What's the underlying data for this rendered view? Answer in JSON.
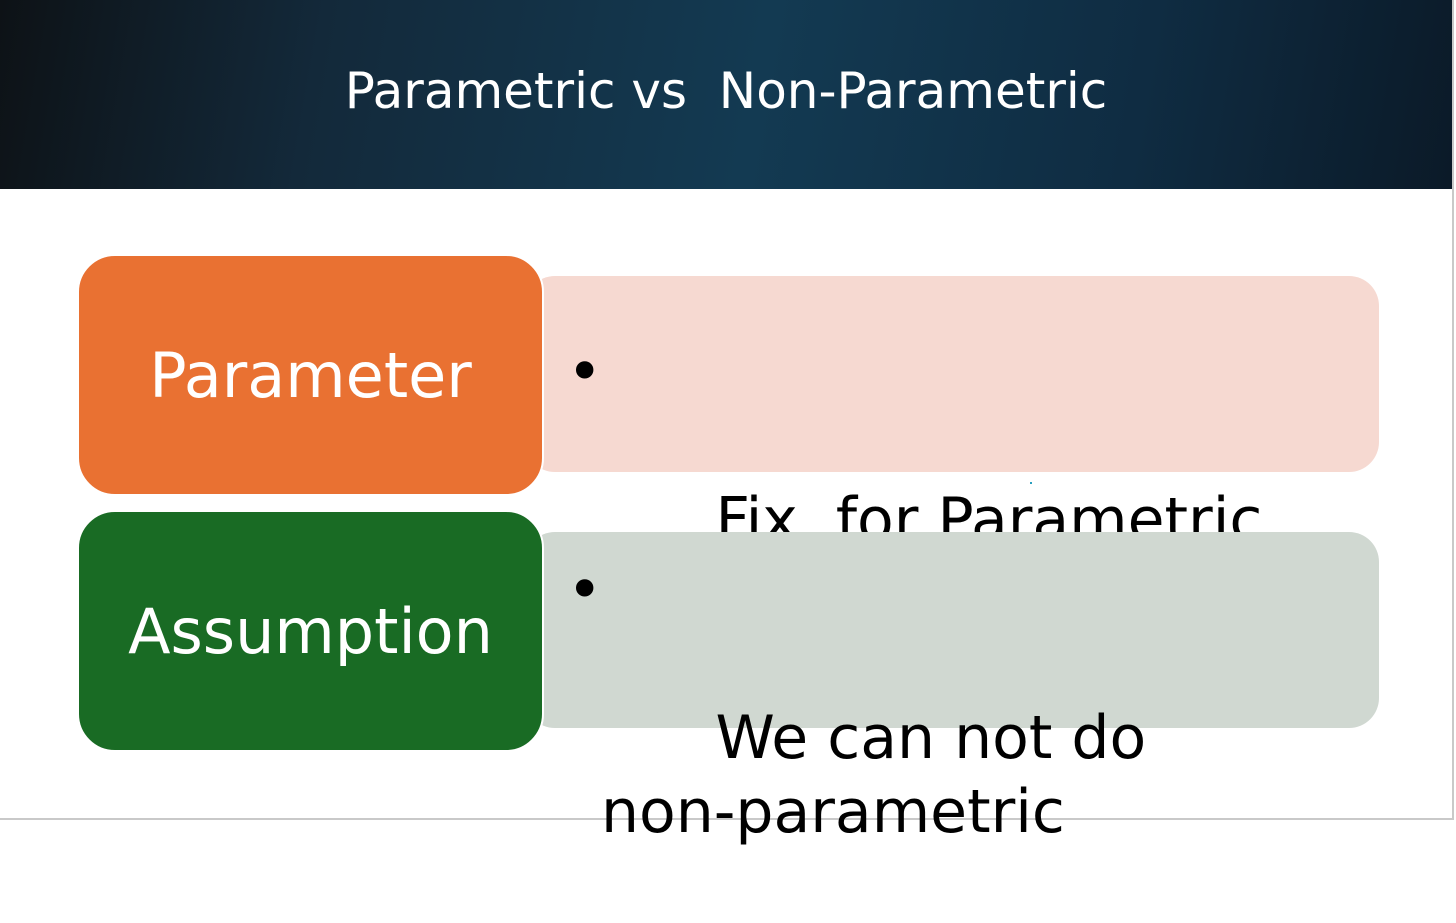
{
  "slide": {
    "title": "Parametric vs  Non-Parametric",
    "rows": [
      {
        "label": "Parameter",
        "label_color": "#E97132",
        "detail_bg": "#F6D9D1",
        "bullets": [
          "Fix  for Parametric"
        ]
      },
      {
        "label": "Assumption",
        "label_color": "#196B24",
        "detail_bg": "#D0D8D1",
        "bullets": [
          "We can not do  non-parametric"
        ]
      }
    ],
    "bullet_glyph": "•"
  }
}
